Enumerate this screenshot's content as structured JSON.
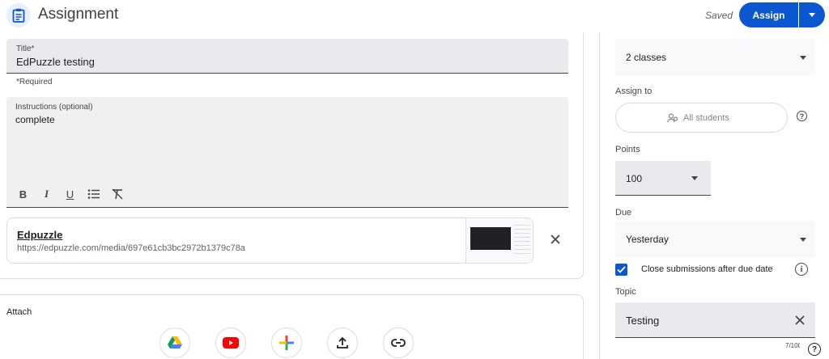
{
  "header": {
    "title": "Assignment",
    "saved_text": "Saved",
    "assign_label": "Assign"
  },
  "form": {
    "title_label": "Title*",
    "title_value": "EdPuzzle testing",
    "required_note": "*Required",
    "instructions_label": "Instructions (optional)",
    "instructions_value": "complete",
    "format": {
      "bold": "B",
      "italic": "I",
      "underline": "U"
    }
  },
  "attachment": {
    "title": "Edpuzzle",
    "url": "https://edpuzzle.com/media/697e61cb3bc2972b1379c78a"
  },
  "attach": {
    "label": "Attach",
    "icons": [
      "drive-icon",
      "youtube-icon",
      "create-icon",
      "upload-icon",
      "link-icon"
    ]
  },
  "sidebar": {
    "for_value": "2 classes",
    "assign_to_label": "Assign to",
    "assign_to_value": "All students",
    "points_label": "Points",
    "points_value": "100",
    "due_label": "Due",
    "due_value": "Yesterday",
    "close_submissions_label": "Close submissions after due date",
    "close_submissions_checked": true,
    "topic_label": "Topic",
    "topic_value": "Testing",
    "topic_counter": "7/100"
  },
  "colors": {
    "accent": "#0b57d0",
    "field_bg": "#e8eaed"
  }
}
